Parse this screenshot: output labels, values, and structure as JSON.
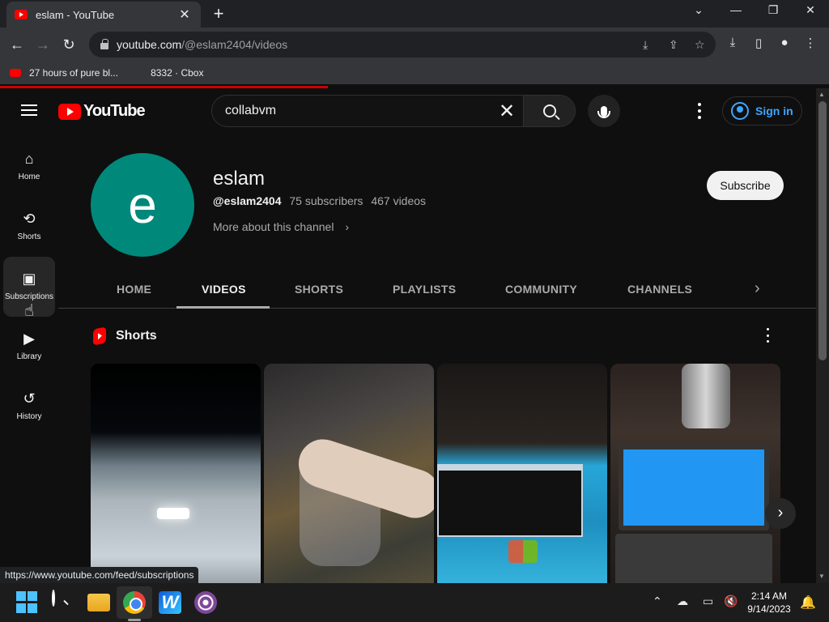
{
  "browser": {
    "tab_title": "eslam - YouTube",
    "url_host": "youtube.com",
    "url_path": "/@eslam2404/videos",
    "bookmarks": [
      {
        "label": "27 hours of pure bl..."
      },
      {
        "label": "8332 · Cbox"
      }
    ],
    "status_url": "https://www.youtube.com/feed/subscriptions"
  },
  "youtube": {
    "logo_text": "YouTube",
    "search_value": "collabvm",
    "signin_label": "Sign in",
    "guide": [
      {
        "label": "Home",
        "icon": "home-icon"
      },
      {
        "label": "Shorts",
        "icon": "shorts-icon"
      },
      {
        "label": "Subscriptions",
        "icon": "subscriptions-icon"
      },
      {
        "label": "Library",
        "icon": "library-icon"
      },
      {
        "label": "History",
        "icon": "history-icon"
      }
    ],
    "channel": {
      "avatar_letter": "e",
      "avatar_color": "#00897b",
      "name": "eslam",
      "handle": "@eslam2404",
      "subscribers": "75 subscribers",
      "videos": "467 videos",
      "more_label": "More about this channel",
      "subscribe_label": "Subscribe"
    },
    "tabs": [
      "HOME",
      "VIDEOS",
      "SHORTS",
      "PLAYLISTS",
      "COMMUNITY",
      "CHANNELS"
    ],
    "selected_tab": "VIDEOS",
    "shelf_title": "Shorts"
  },
  "taskbar": {
    "time": "2:14 AM",
    "date": "9/14/2023"
  },
  "colors": {
    "accent_red": "#ff0000",
    "link_blue": "#3ea6ff",
    "background": "#0f0f0f"
  }
}
